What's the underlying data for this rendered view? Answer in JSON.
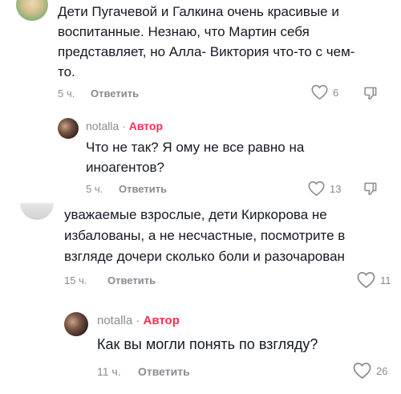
{
  "comments": [
    {
      "lines": [
        "Дети Пугачевой и Галкина очень красивые и",
        "воспитанные. Незнаю, что Мартин себя",
        "представляет, но Алла- Виктория что-то с чем-",
        "то."
      ],
      "time": "5 ч.",
      "reply_label": "Ответить",
      "likes": "6",
      "reply": {
        "username": "notalla",
        "separator": "·",
        "badge": "Автор",
        "lines": [
          "Что не так? Я ому не все равно на",
          "иноагентов?"
        ],
        "time": "5 ч.",
        "reply_label": "Ответить",
        "likes": "13"
      }
    },
    {
      "lines": [
        "уважаемые взрослые, дети Киркорова не",
        "избалованы, а не несчастные, посмотрите в",
        "взгляде дочери сколько боли и разочарован"
      ],
      "time": "15 ч.",
      "reply_label": "Ответить",
      "likes": "11",
      "reply": {
        "username": "notalla",
        "separator": "·",
        "badge": "Автор",
        "lines": [
          "Как вы могли понять по взгляду?"
        ],
        "time": "11 ч.",
        "reply_label": "Ответить",
        "likes": "26"
      }
    }
  ],
  "colors": {
    "author_badge": "#fe2c55",
    "meta": "#8a8b91",
    "text": "#161823"
  }
}
